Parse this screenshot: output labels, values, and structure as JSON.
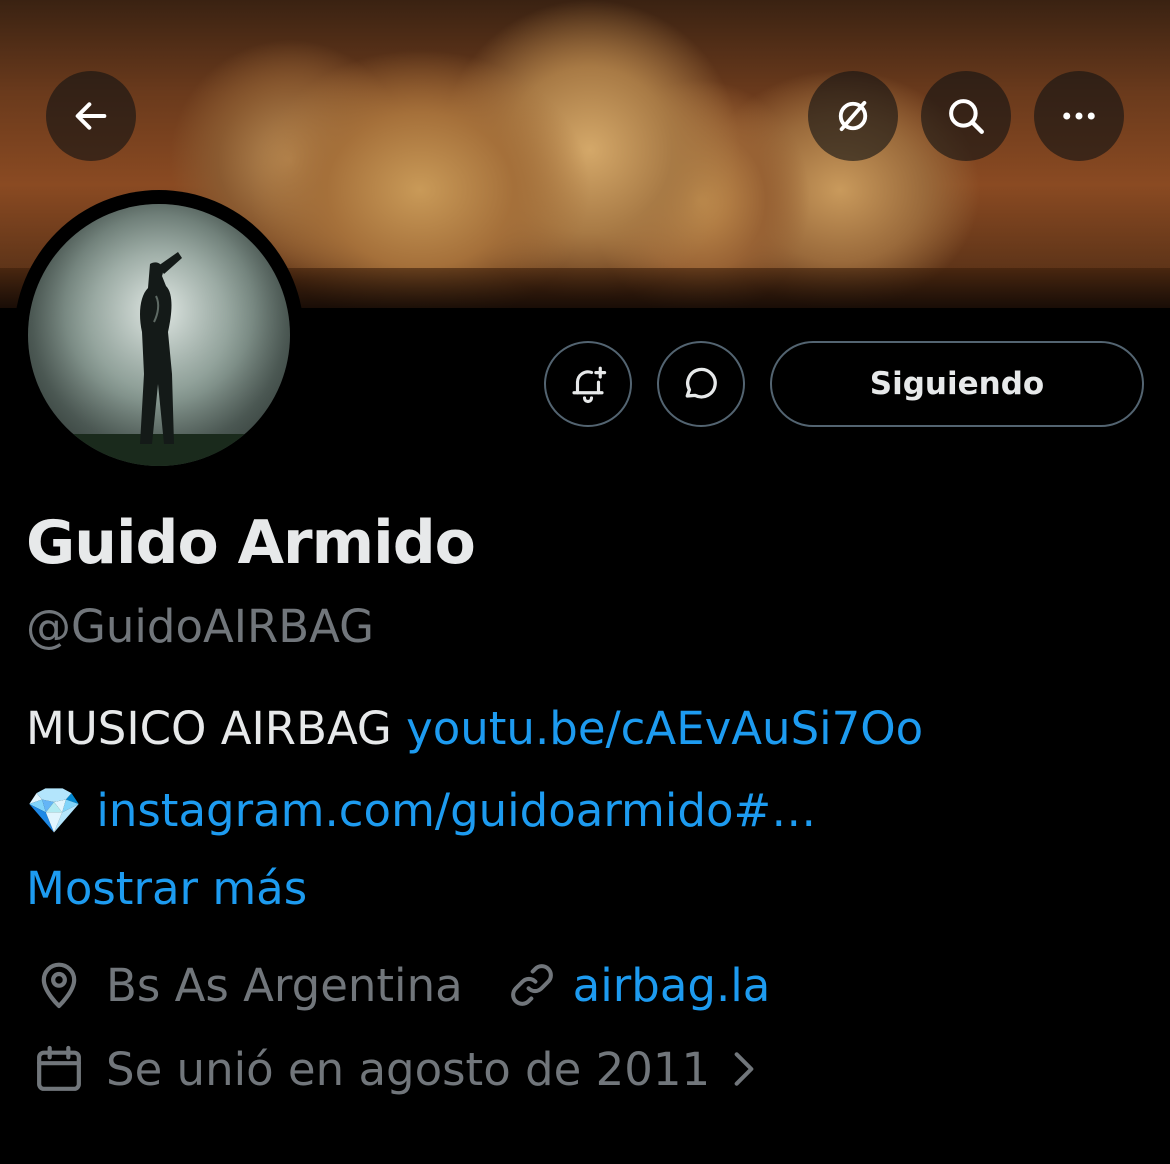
{
  "header": {
    "back_icon": "arrow-left-icon",
    "grok_icon": "slashed-circle-icon",
    "search_icon": "search-icon",
    "more_icon": "more-dots-icon"
  },
  "actions": {
    "notify_icon": "bell-plus-icon",
    "message_icon": "chat-bubble-icon",
    "following_label": "Siguiendo"
  },
  "profile": {
    "display_name": "Guido Armido",
    "handle": "@GuidoAIRBAG",
    "bio_text": "MUSICO AIRBAG ",
    "bio_link_youtube": "youtu.be/cAEvAuSi7Oo",
    "bio_emoji": "💎",
    "bio_link_instagram": "instagram.com/guidoarmido#…",
    "show_more": "Mostrar más",
    "location": "Bs As Argentina",
    "website": "airbag.la",
    "joined": "Se unió en agosto de 2011"
  },
  "colors": {
    "background": "#000000",
    "text_primary": "#e7e9ea",
    "text_secondary": "#71767b",
    "link": "#1d9bf0",
    "border": "#536471"
  }
}
